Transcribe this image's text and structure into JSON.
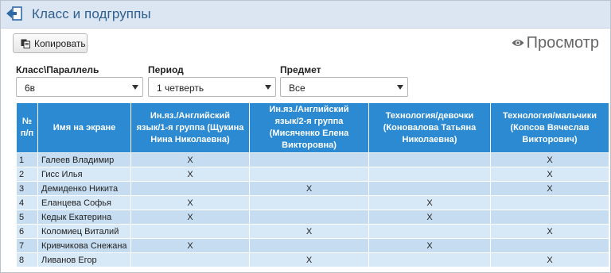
{
  "header": {
    "title": "Класс и подгруппы",
    "back_icon": "back-arrow-icon"
  },
  "toolbar": {
    "copy_label": "Копировать",
    "copy_icon": "copy-icon",
    "view_label": "Просмотр",
    "view_icon": "eye-icon"
  },
  "filters": {
    "class_label": "Класс\\Параллель",
    "class_value": "6в",
    "period_label": "Период",
    "period_value": "1 четверть",
    "subject_label": "Предмет",
    "subject_value": "Все"
  },
  "table": {
    "columns": [
      "№ п/п",
      "Имя на экране",
      "Ин.яз./Английский язык/1-я группа (Щукина Нина Николаевна)",
      "Ин.яз./Английский язык/2-я группа (Мисяченко Елена Викторовна)",
      "Технология/девочки (Коновалова Татьяна Николаевна)",
      "Технология/мальчики (Копсов Вячеслав Викторович)"
    ],
    "rows": [
      {
        "num": "1",
        "name": "Галеев Владимир",
        "g1": "X",
        "g2": "",
        "g3": "",
        "g4": "X"
      },
      {
        "num": "2",
        "name": "Гисс Илья",
        "g1": "X",
        "g2": "",
        "g3": "",
        "g4": "X"
      },
      {
        "num": "3",
        "name": "Демиденко Никита",
        "g1": "",
        "g2": "X",
        "g3": "",
        "g4": "X"
      },
      {
        "num": "4",
        "name": "Еланцева Софья",
        "g1": "X",
        "g2": "",
        "g3": "X",
        "g4": ""
      },
      {
        "num": "5",
        "name": "Кедык Екатерина",
        "g1": "X",
        "g2": "",
        "g3": "X",
        "g4": ""
      },
      {
        "num": "6",
        "name": "Коломиец Виталий",
        "g1": "",
        "g2": "X",
        "g3": "",
        "g4": "X"
      },
      {
        "num": "7",
        "name": "Кривчикова Снежана",
        "g1": "X",
        "g2": "",
        "g3": "X",
        "g4": ""
      },
      {
        "num": "8",
        "name": "Ливанов Егор",
        "g1": "",
        "g2": "X",
        "g3": "",
        "g4": "X"
      }
    ]
  }
}
